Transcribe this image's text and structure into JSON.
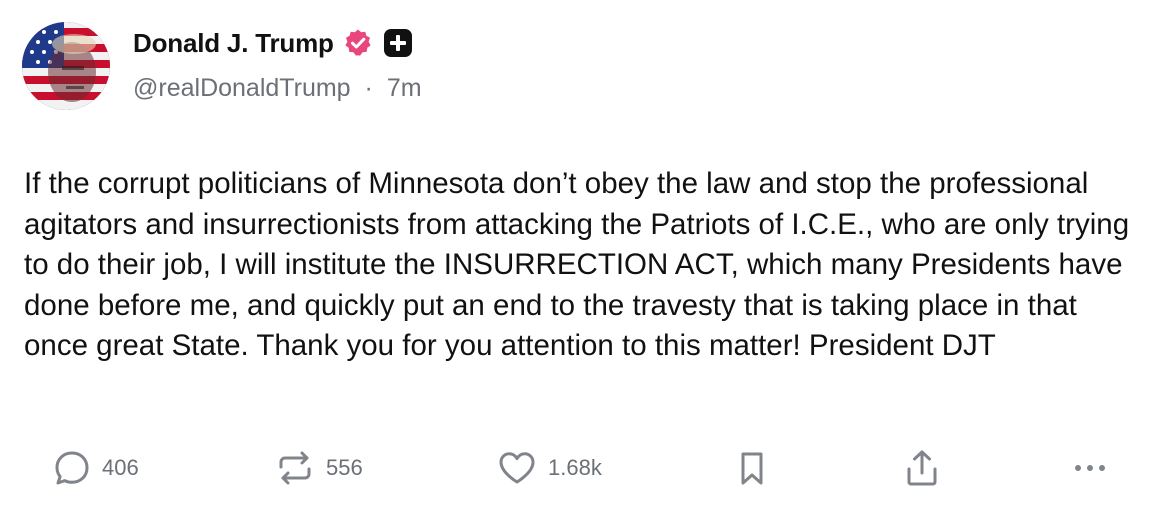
{
  "author": {
    "display_name": "Donald J. Trump",
    "handle": "@realDonaldTrump",
    "separator": "·",
    "time_ago": "7m",
    "verified_color": "#e8467c"
  },
  "post": {
    "text": "If the corrupt politicians of Minnesota don’t obey the law and stop the professional agitators and insurrectionists from attacking the Patriots of I.C.E., who are only trying to do their job, I will institute the INSURRECTION ACT, which many Presidents have done before me, and quickly put an end to the travesty that is taking place in that once great State. Thank you for you attention to this matter! President DJT"
  },
  "actions": {
    "reply": {
      "icon": "reply-icon",
      "count": "406"
    },
    "repost": {
      "icon": "repost-icon",
      "count": "556"
    },
    "like": {
      "icon": "heart-icon",
      "count": "1.68k"
    },
    "bookmark": {
      "icon": "bookmark-icon"
    },
    "share": {
      "icon": "share-icon"
    },
    "more": {
      "icon": "more-icon"
    }
  },
  "colors": {
    "text": "#111111",
    "muted": "#6b6f76",
    "icon": "#80848b"
  }
}
